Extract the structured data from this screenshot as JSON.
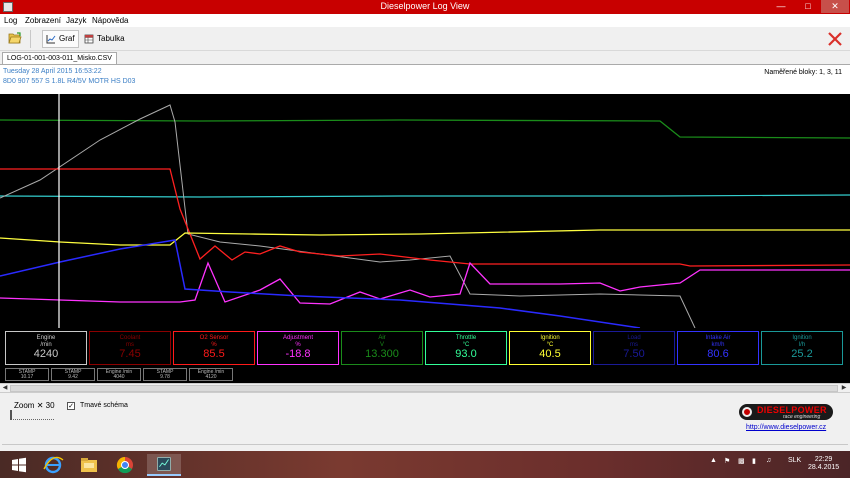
{
  "window": {
    "title": "Dieselpower Log View",
    "min": "—",
    "max": "□",
    "close": "✕"
  },
  "menu": [
    "Log",
    "Zobrazení",
    "Jazyk",
    "Nápověda"
  ],
  "toolbar": {
    "graph_label": "Graf",
    "table_label": "Tabulka"
  },
  "file_tab": "LOG-01-001-003-011_Misko.CSV",
  "info": {
    "datetime": "Tuesday 28 April 2015 16:53:22",
    "vehicle": "8D0 907 557 S   1.8L R4/5V   MOTR HS D03",
    "measured_blocks": "Naměřené bloky: 1, 3, 11"
  },
  "gauges": [
    {
      "name": "Engine",
      "unit": "/min",
      "value": "4240",
      "color": "#c8c8c8"
    },
    {
      "name": "Coolant",
      "unit": "ms",
      "value": "7.45",
      "color": "#8b0000"
    },
    {
      "name": "O2 Sensor",
      "unit": "%",
      "value": "85.5",
      "color": "#ff1a1a"
    },
    {
      "name": "Adjustment",
      "unit": "%",
      "value": "-18.8",
      "color": "#ff33ff"
    },
    {
      "name": "Air",
      "unit": "V",
      "value": "13.300",
      "color": "#1a8c1a"
    },
    {
      "name": "Throttle",
      "unit": "°C",
      "value": "93.0",
      "color": "#33ff99"
    },
    {
      "name": "Ignition",
      "unit": "°C",
      "value": "40.5",
      "color": "#ffff33"
    },
    {
      "name": "Load",
      "unit": "ms",
      "value": "7.50",
      "color": "#1a1a99"
    },
    {
      "name": "Intake Air",
      "unit": "km/h",
      "value": "80.6",
      "color": "#3333ff"
    },
    {
      "name": "Ignition",
      "unit": "l/h",
      "value": "25.2",
      "color": "#1a9999"
    }
  ],
  "stamps": [
    {
      "label": "STAMP",
      "value": "10.17"
    },
    {
      "label": "STAMP",
      "value": "9.42"
    },
    {
      "label": "Engine /min",
      "value": "4040"
    },
    {
      "label": "STAMP",
      "value": "9.78"
    },
    {
      "label": "Engine /min",
      "value": "4120"
    }
  ],
  "zoom": {
    "label": "Zoom",
    "value": "30"
  },
  "dark_scheme": {
    "label": "Tmavé schéma",
    "checked": true
  },
  "logo": {
    "brand": "DIESELPOWER",
    "tagline": "race engineering"
  },
  "link": "http://www.dieselpower.cz",
  "colors": {
    "titlebar": "#c80000",
    "chart_bg": "#000000",
    "info_text": "#3a7ec5"
  },
  "taskbar": {
    "tray_lang": "SLK",
    "time": "22:29",
    "date": "28.4.2015"
  }
}
